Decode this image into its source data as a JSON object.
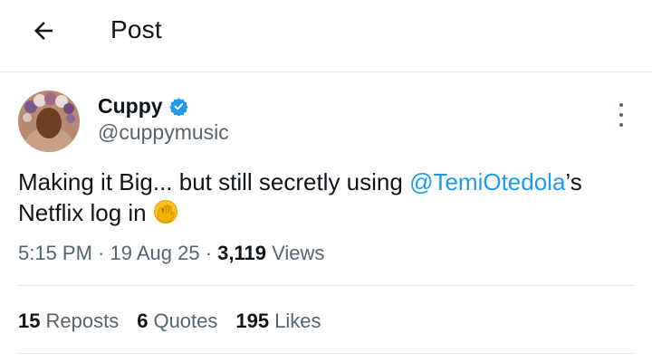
{
  "header": {
    "title": "Post",
    "back_icon": "arrow-left-icon"
  },
  "author": {
    "name": "Cuppy",
    "handle": "@cuppymusic",
    "verified_icon": "verified-badge-icon",
    "avatar_icon": "avatar"
  },
  "more_icon": "more-vertical-icon",
  "tweet": {
    "text_before": "Making it Big... but still secretly using ",
    "mention": "@TemiOtedola",
    "text_after": "’s Netflix log in ",
    "emoji": "face-with-peeking-eye-emoji"
  },
  "meta": {
    "time": "5:15 PM",
    "sep1": " · ",
    "date": "19 Aug 25",
    "sep2": " · ",
    "views_count": "3,119",
    "views_label": " Views"
  },
  "stats": [
    {
      "count": "15",
      "label": "Reposts"
    },
    {
      "count": "6",
      "label": "Quotes"
    },
    {
      "count": "195",
      "label": "Likes"
    }
  ],
  "colors": {
    "accent": "#1d9bf0",
    "text": "#0f1419",
    "secondary": "#536471",
    "divider": "#e3e6e8"
  }
}
